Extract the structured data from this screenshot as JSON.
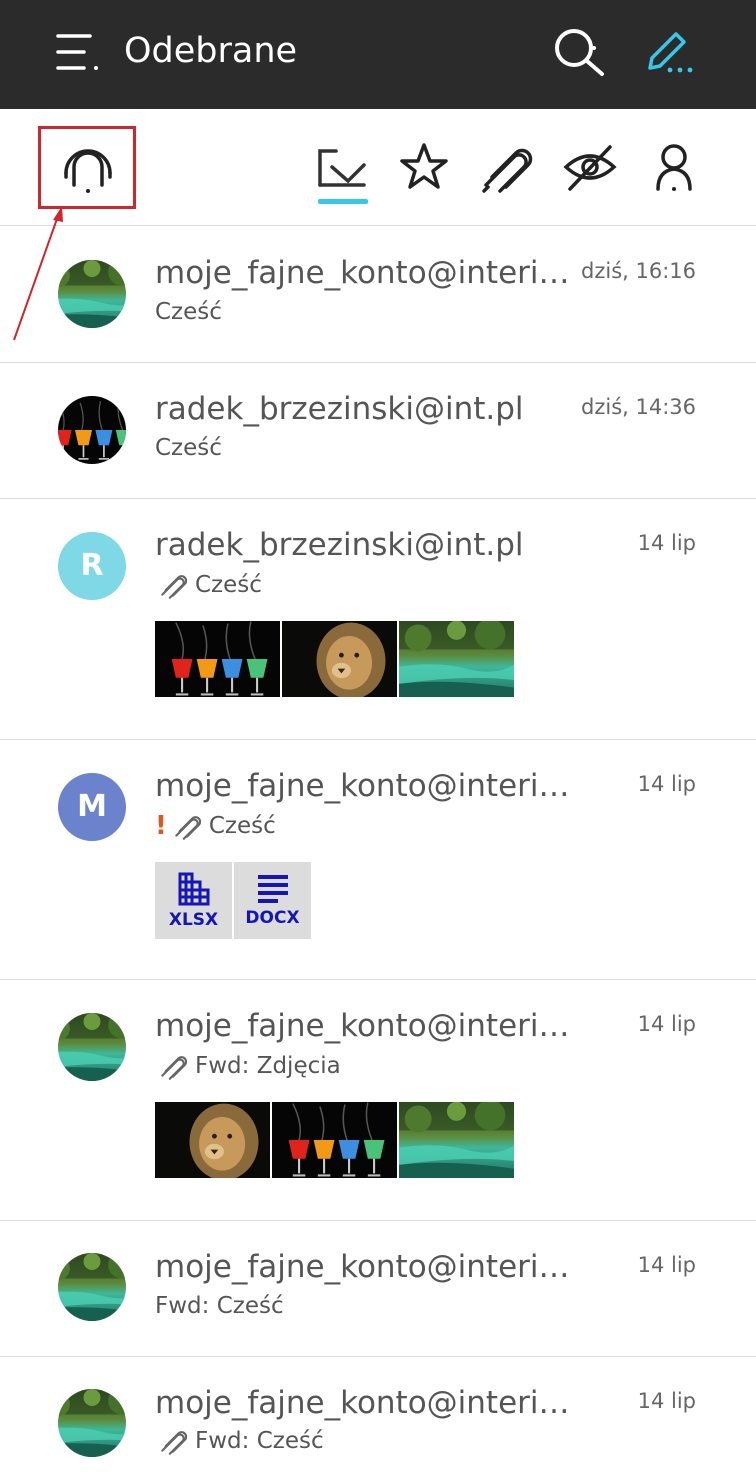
{
  "appbar": {
    "title": "Odebrane",
    "icons": [
      "menu-icon",
      "search-icon",
      "compose-icon"
    ],
    "accent_color": "#36c8e6",
    "background_color": "#2b2b2b"
  },
  "filters": {
    "items": [
      "unread-filter-icon",
      "inbox-filter-icon",
      "starred-filter-icon",
      "attachment-filter-icon",
      "hidden-filter-icon",
      "contacts-filter-icon"
    ],
    "active": "inbox-filter-icon",
    "highlight_color": "#d0262b"
  },
  "messages": [
    {
      "sender": "moje_fajne_konto@interia.pl",
      "date": "dziś, 16:16",
      "subject": "Cześć",
      "avatar": "river-photo",
      "attachment": false,
      "important": false
    },
    {
      "sender": "radek_brzezinski@int.pl",
      "date": "dziś, 14:36",
      "subject": "Cześć",
      "avatar": "glasses-photo",
      "attachment": false,
      "important": false
    },
    {
      "sender": "radek_brzezinski@int.pl",
      "date": "14 lip",
      "subject": "Cześć",
      "avatar_letter": "R",
      "avatar_color": "#7fd8e6",
      "attachment": true,
      "important": false,
      "thumbnails": [
        "glasses-photo",
        "lion-photo",
        "river-photo"
      ]
    },
    {
      "sender": "moje_fajne_konto@interia.pl",
      "date": "14 lip",
      "subject": "Cześć",
      "avatar_letter": "M",
      "avatar_color": "#6b83cc",
      "attachment": true,
      "important": true,
      "important_mark": "!",
      "files": [
        "XLSX",
        "DOCX"
      ]
    },
    {
      "sender": "moje_fajne_konto@interia.pl",
      "date": "14 lip",
      "subject": "Fwd: Zdjęcia",
      "avatar": "river-photo",
      "attachment": true,
      "important": false,
      "thumbnails": [
        "lion-photo",
        "glasses-photo",
        "river-photo"
      ]
    },
    {
      "sender": "moje_fajne_konto@interia.pl",
      "date": "14 lip",
      "subject": "Fwd: Cześć",
      "avatar": "river-photo",
      "attachment": false,
      "important": false
    },
    {
      "sender": "moje_fajne_konto@interia.pl",
      "date": "14 lip",
      "subject": "Fwd: Cześć",
      "avatar": "river-photo",
      "attachment": true,
      "important": false
    }
  ]
}
